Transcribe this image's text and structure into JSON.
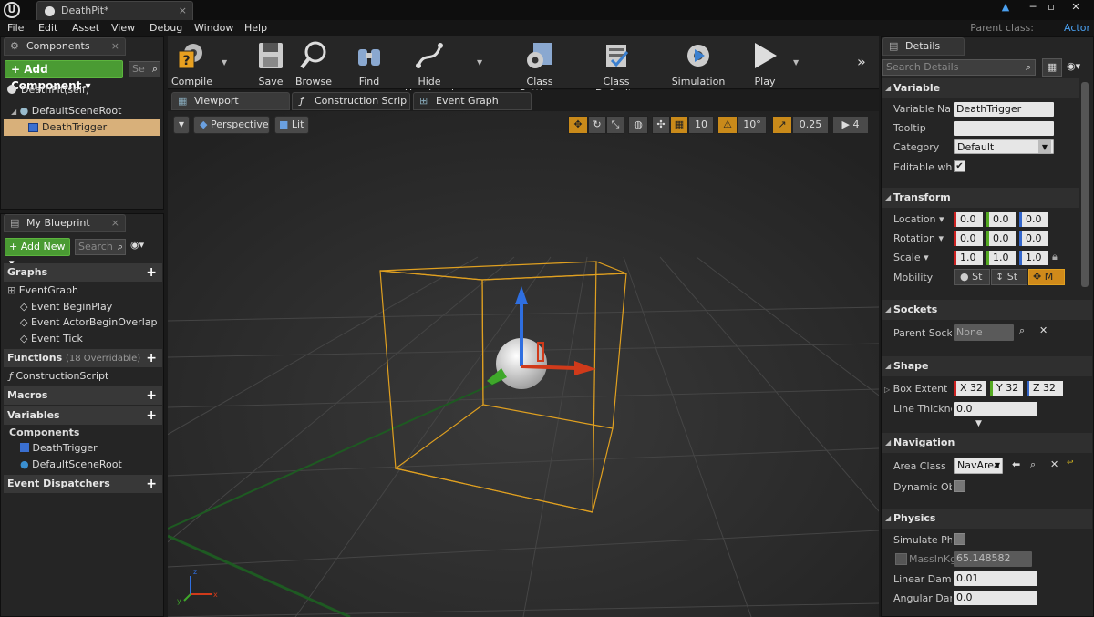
{
  "window": {
    "tab_title": "DeathPit*",
    "parent_class_label": "Parent class:",
    "parent_class_value": "Actor"
  },
  "menu": [
    "File",
    "Edit",
    "Asset",
    "View",
    "Debug",
    "Window",
    "Help"
  ],
  "components_panel": {
    "tab": "Components",
    "add_button": "+ Add Component ▾",
    "search_placeholder": "Se",
    "self_item": "DeathPit(self)",
    "tree": [
      "DefaultSceneRoot",
      "DeathTrigger"
    ]
  },
  "blueprint_panel": {
    "tab": "My Blueprint",
    "add_new": "+ Add New ▾",
    "search_placeholder": "Search",
    "graphs_header": "Graphs",
    "graphs": [
      "EventGraph",
      "Event BeginPlay",
      "Event ActorBeginOverlap",
      "Event Tick"
    ],
    "functions_header": "Functions",
    "functions_note": "(18 Overridable)",
    "functions": [
      "ConstructionScript"
    ],
    "macros_header": "Macros",
    "variables_header": "Variables",
    "components_header": "Components",
    "components": [
      "DeathTrigger",
      "DefaultSceneRoot"
    ],
    "dispatchers_header": "Event Dispatchers"
  },
  "toolbar": {
    "compile": "Compile",
    "save": "Save",
    "browse": "Browse",
    "find": "Find",
    "hide_unrelated": "Hide Unrelated",
    "class_settings": "Class Settings",
    "class_defaults": "Class Defaults",
    "simulation": "Simulation",
    "play": "Play"
  },
  "editor_tabs": [
    "Viewport",
    "Construction Scrip",
    "Event Graph"
  ],
  "viewport_bar": {
    "perspective": "Perspective",
    "lit": "Lit",
    "grid_snap": "10",
    "rot_snap": "10°",
    "scale_snap": "0.25",
    "cam_speed": "4"
  },
  "details": {
    "tab": "Details",
    "search_placeholder": "Search Details",
    "variable": {
      "header": "Variable",
      "name_label": "Variable Nam",
      "name_value": "DeathTrigger",
      "tooltip_label": "Tooltip",
      "tooltip_value": "",
      "category_label": "Category",
      "category_value": "Default",
      "editable_label": "Editable when"
    },
    "transform": {
      "header": "Transform",
      "location_label": "Location ▾",
      "location": [
        "0.0",
        "0.0",
        "0.0"
      ],
      "rotation_label": "Rotation ▾",
      "rotation": [
        "0.0",
        "0.0",
        "0.0"
      ],
      "scale_label": "Scale ▾",
      "scale": [
        "1.0",
        "1.0",
        "1.0"
      ],
      "mobility_label": "Mobility",
      "mobility": [
        "St",
        "St",
        "M"
      ]
    },
    "sockets": {
      "header": "Sockets",
      "parent_label": "Parent Socke",
      "parent_value": "None"
    },
    "shape": {
      "header": "Shape",
      "box_label": "Box Extent",
      "box": [
        "X  32",
        "Y  32",
        "Z  32"
      ],
      "line_label": "Line Thickne",
      "line_value": "0.0"
    },
    "navigation": {
      "header": "Navigation",
      "area_label": "Area Class",
      "area_value": "NavArea",
      "dynamic_label": "Dynamic Obst"
    },
    "physics": {
      "header": "Physics",
      "simulate_label": "Simulate Phys",
      "mass_label": "MassInKg",
      "mass_value": "65.148582",
      "linear_label": "Linear Dampir",
      "linear_value": "0.01",
      "angular_label": "Angular Damp",
      "angular_value": "0.0"
    }
  },
  "colors": {
    "accent_green": "#4a9b33",
    "selection_orange": "#e0a020",
    "highlight_row": "#d8b07a",
    "link_blue": "#4aa0f0"
  }
}
